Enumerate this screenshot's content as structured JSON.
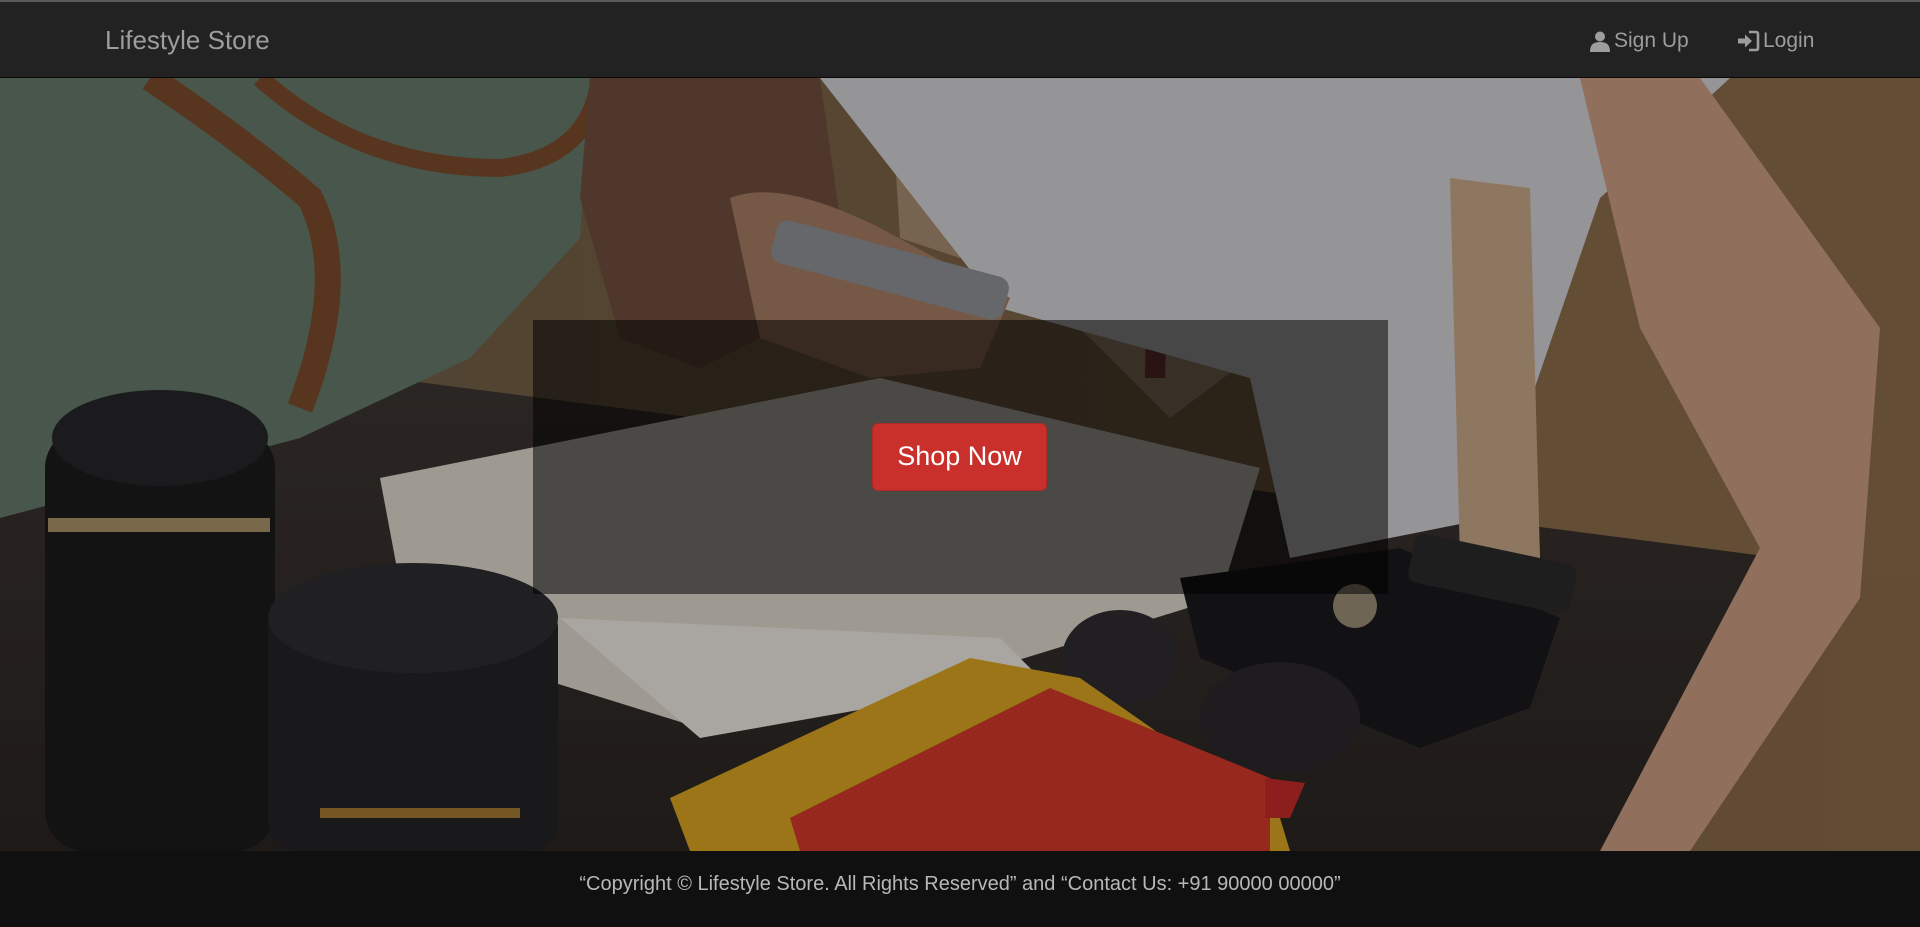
{
  "navbar": {
    "brand": "Lifestyle Store",
    "links": [
      {
        "label": "Sign Up",
        "icon": "user-icon"
      },
      {
        "label": "Login",
        "icon": "login-icon"
      }
    ]
  },
  "hero": {
    "cta_label": "Shop Now",
    "background": "photo of lifestyle products on a wooden table",
    "cta_color": "#c9302c"
  },
  "footer": {
    "text": "“Copyright © Lifestyle Store. All Rights Reserved” and “Contact Us: +91 90000 00000”"
  }
}
